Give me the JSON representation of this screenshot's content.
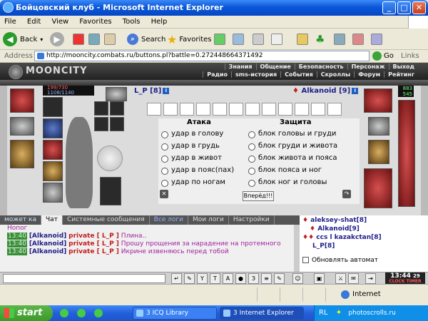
{
  "window": {
    "title": "Бойцовский клуб - Microsoft Internet Explorer",
    "min": "_",
    "max": "□",
    "close": "✕"
  },
  "menu": [
    "File",
    "Edit",
    "View",
    "Favorites",
    "Tools",
    "Help"
  ],
  "toolbar": {
    "back": "Back",
    "search": "Search",
    "favorites": "Favorites"
  },
  "address": {
    "label": "Address",
    "url": "http://mooncity.combats.ru/buttons.pl?battle=0.272448664371492",
    "go": "Go",
    "links": "Links"
  },
  "game": {
    "logo": "MOONCITY",
    "nav_top": [
      "Знания",
      "Общение",
      "Безопасность",
      "Персонаж",
      "Выход"
    ],
    "nav_bottom": [
      "Радио",
      "sms-история",
      "События",
      "Скроллы",
      "Форум",
      "Рейтинг"
    ],
    "hp": "199/730",
    "mp": "1108/1140",
    "opp_stats": [
      "883",
      "545"
    ],
    "player": {
      "name": "L_P [8]"
    },
    "opponent": {
      "name": "Alkanoid [9]"
    },
    "attack_header": "Атака",
    "defense_header": "Защита",
    "attack_options": [
      "удар в голову",
      "удар в грудь",
      "удар в живот",
      "удар в пояс(пах)",
      "удар по ногам"
    ],
    "defense_options": [
      "блок головы и груди",
      "блок груди и живота",
      "блок живота и пояса",
      "блок пояса и ног",
      "блок ног и головы"
    ],
    "forward_button": "Вперёд!!!",
    "arrow_left": "✕",
    "arrow_right": "↷"
  },
  "chat": {
    "left_label": "может ка",
    "tabs": [
      "Чат",
      "Системные сообщения",
      "Все логи",
      "Мои логи",
      "Настройки"
    ],
    "prefix": "Hопог",
    "messages": [
      {
        "time": "13:40",
        "from": "[Alkanoid]",
        "private": "private [ L_P ]",
        "text": "Плина.."
      },
      {
        "time": "13:40",
        "from": "[Alkanoid]",
        "private": "private [ L_P ]",
        "text": "Прошу прощения за нарадение на протемного"
      },
      {
        "time": "13:40",
        "from": "[Alkanoid]",
        "private": "private [ L_P ]",
        "text": "Икрине извеняюсь перед тобой"
      }
    ],
    "users": [
      "aleksey-shat[8]",
      "Alkanoid[9]",
      "ccs l kazakctan[8]",
      "L_P[8]"
    ],
    "refresh_label": "Обновлять автомат",
    "clock": "13:44",
    "clock_sub": "CLOCK TIMER",
    "clock_seconds": "29"
  },
  "status": {
    "zone": "Internet"
  },
  "taskbar": {
    "start": "start",
    "tasks": [
      "3 ICQ Library",
      "3 Internet Explorer"
    ],
    "tray_lang": "RL",
    "watermark": "photoscrolls.ru"
  }
}
